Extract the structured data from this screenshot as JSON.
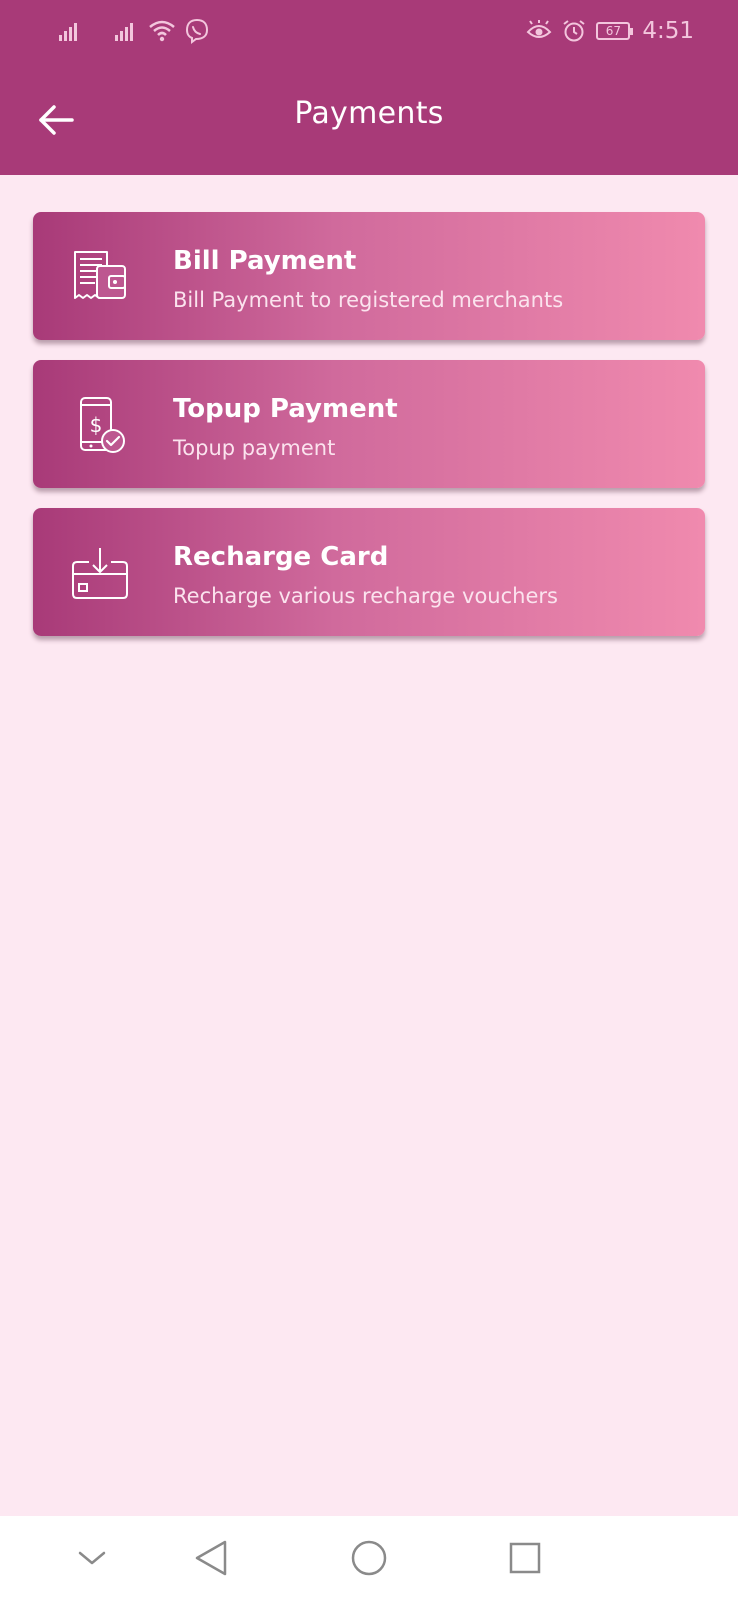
{
  "status_bar": {
    "time": "4:51",
    "battery_level": "67",
    "icons": [
      "signal-icon",
      "signal-icon",
      "wifi-icon",
      "viber-icon",
      "eye-icon",
      "alarm-icon",
      "battery-icon"
    ]
  },
  "app_bar": {
    "title": "Payments",
    "back_icon": "arrow-left-icon"
  },
  "payment_options": [
    {
      "title": "Bill Payment",
      "subtitle": "Bill Payment to registered merchants",
      "icon": "bill-wallet-icon"
    },
    {
      "title": "Topup Payment",
      "subtitle": "Topup payment",
      "icon": "phone-dollar-icon"
    },
    {
      "title": "Recharge Card",
      "subtitle": "Recharge various recharge vouchers",
      "icon": "card-download-icon"
    }
  ],
  "navigation_bar": {
    "icons": [
      "chevron-down-icon",
      "back-triangle-icon",
      "home-circle-icon",
      "recents-square-icon"
    ]
  },
  "colors": {
    "header": "#a83a78",
    "background": "#fde8f2",
    "card_gradient_start": "#a83a78",
    "card_gradient_end": "#f08aae"
  }
}
